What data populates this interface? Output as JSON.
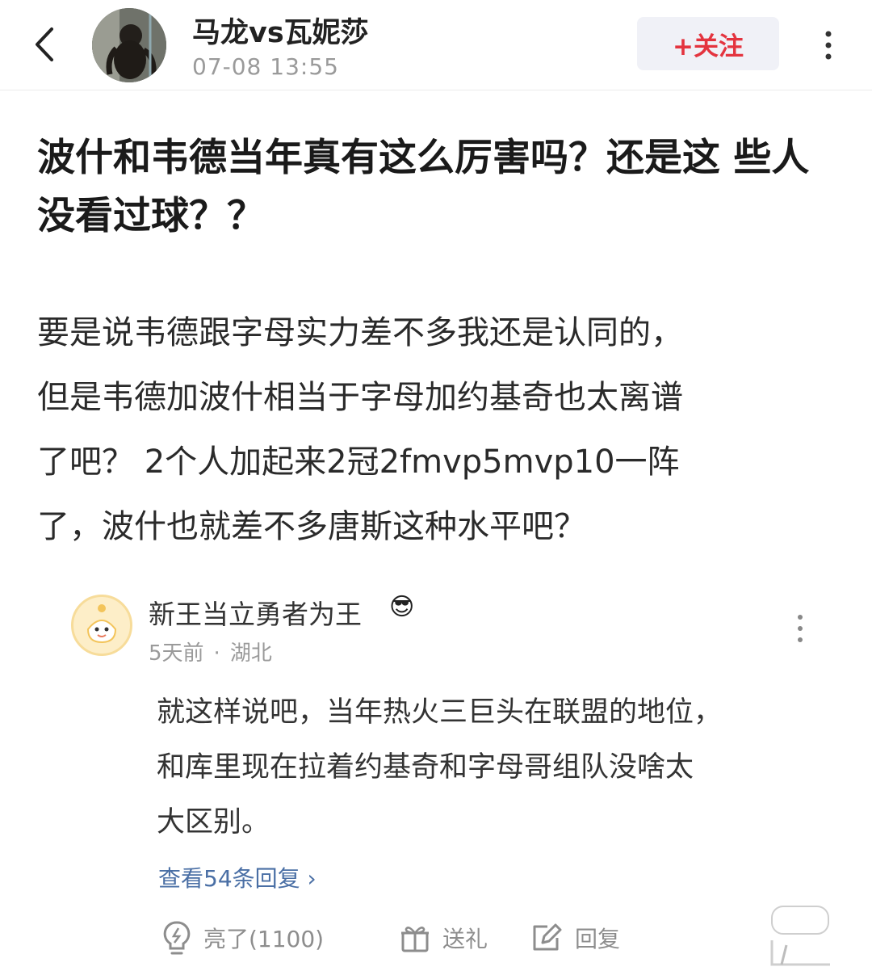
{
  "header": {
    "username": "马龙vs瓦妮莎",
    "timestamp": "07-08 13:55",
    "follow_label": "+关注"
  },
  "post": {
    "title_lines": [
      "波什和韦德当年真有这么厉害吗？还是这",
      "些人没看过球？？"
    ],
    "body_lines": [
      "要是说韦德跟字母实力差不多我还是认同的，",
      "但是韦德加波什相当于字母加约基奇也太离谱",
      "了吧？ 2个人加起来2冠2fmvp5mvp10一阵",
      "了，波什也就差不多唐斯这种水平吧？"
    ]
  },
  "comment": {
    "author": "新王当立勇者为王",
    "emoji": "😎",
    "time": "5天前",
    "separator": "·",
    "location": "湖北",
    "text_lines": [
      "就这样说吧，当年热火三巨头在联盟的地位，",
      "和库里现在拉着约基奇和字母哥组队没啥太",
      "大区别。"
    ],
    "view_replies": "查看54条回复 ›",
    "actions": {
      "like": "亮了(1100)",
      "gift": "送礼",
      "reply": "回复"
    }
  },
  "icons": {
    "back": "chevron-left-icon",
    "more": "vertical-dots-icon",
    "like": "lightbulb-icon",
    "gift": "gift-icon",
    "reply": "edit-icon"
  },
  "colors": {
    "follow_text": "#e4343f",
    "follow_bg": "#f0f1f7",
    "link": "#4a6fa5",
    "muted": "#9a9a9a"
  }
}
